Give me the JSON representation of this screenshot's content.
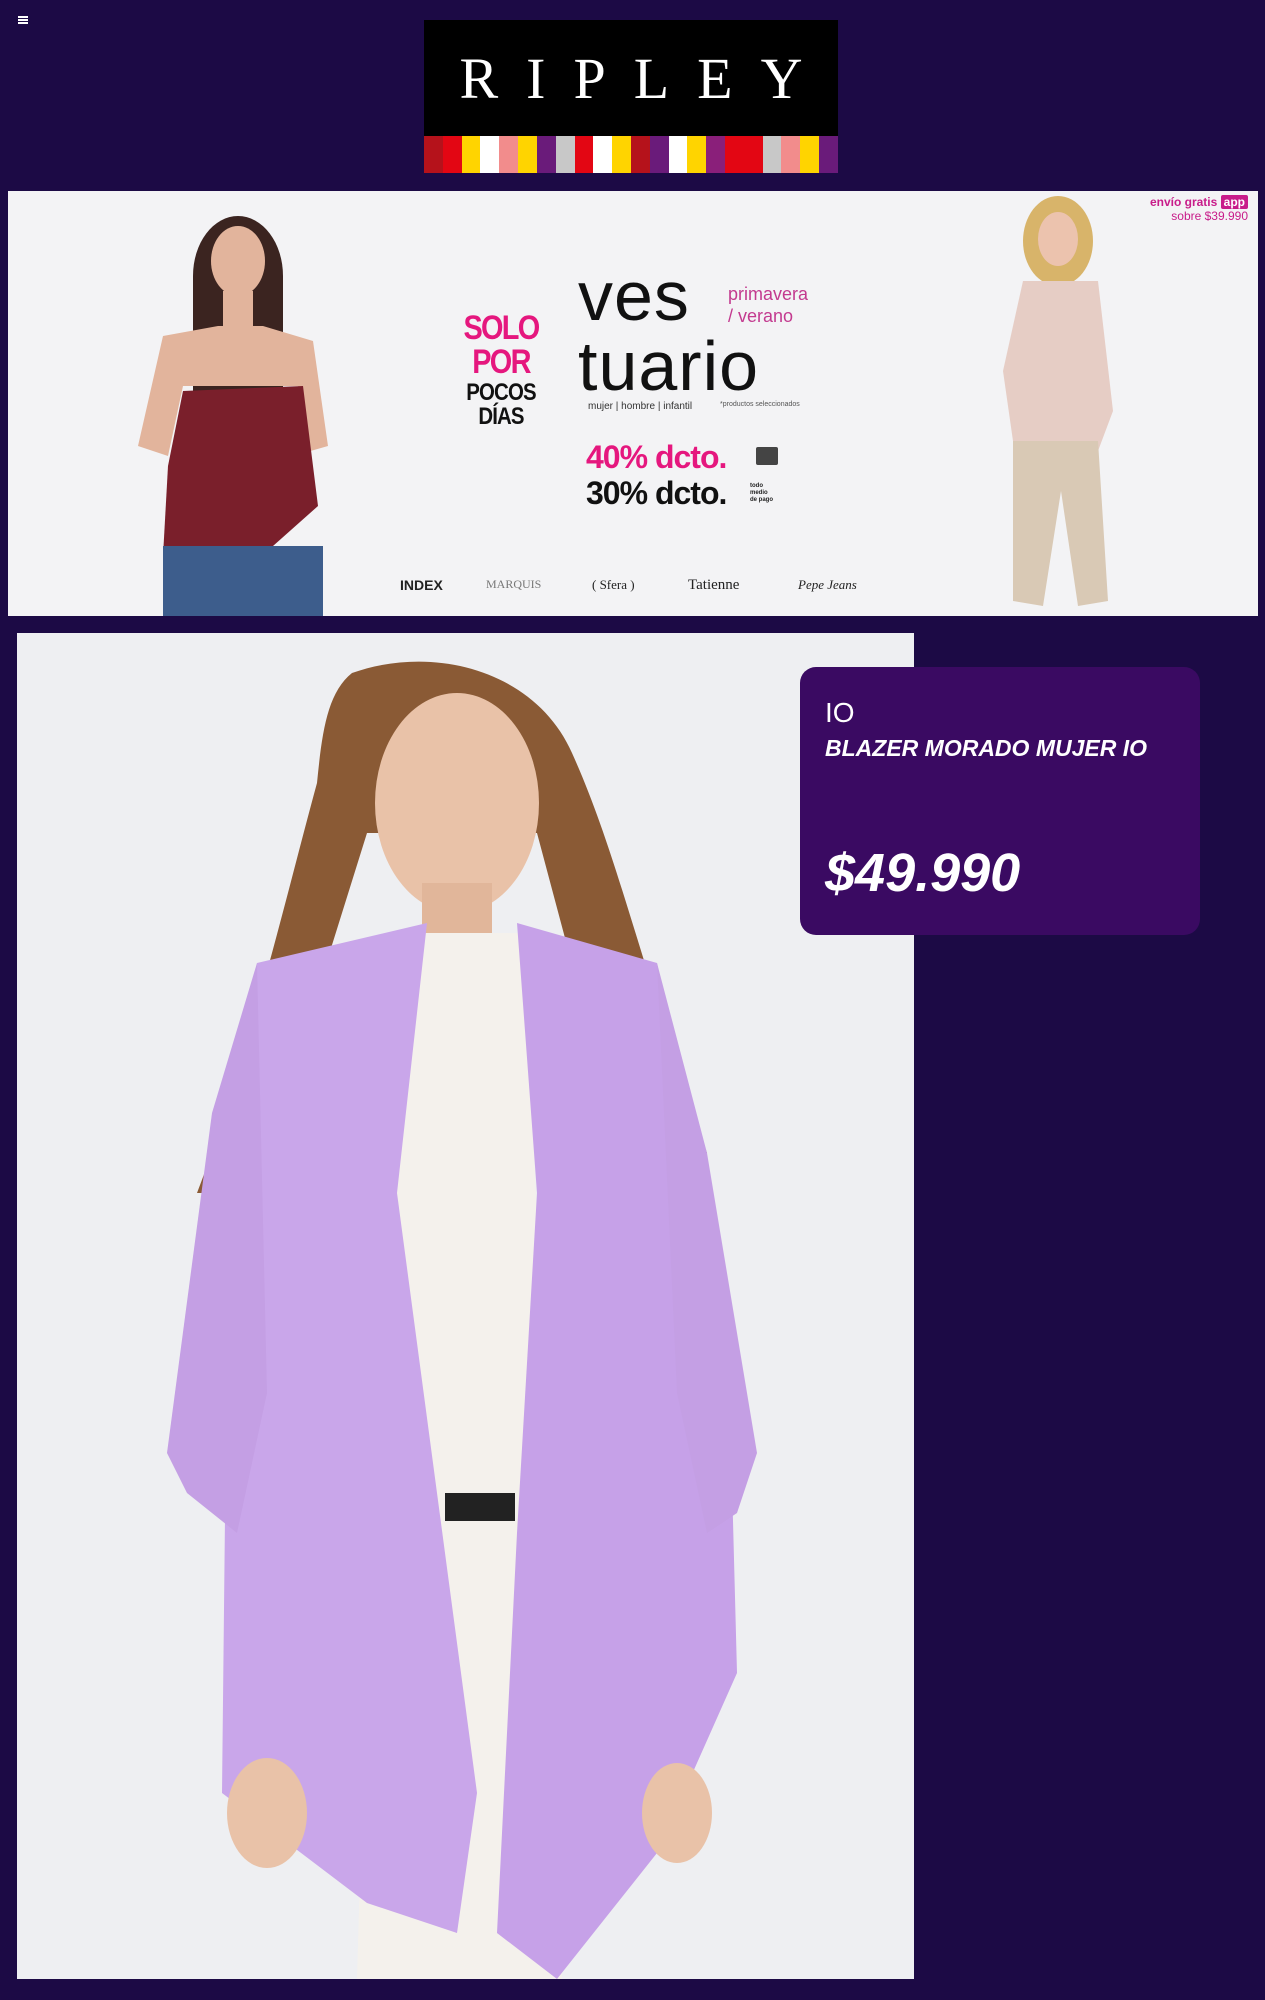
{
  "header": {
    "menu_icon": "menu-icon",
    "logo_text": "RIPLEY",
    "logo_stripe_colors": [
      "#b5121b",
      "#e30613",
      "#ffd400",
      "#ffffff",
      "#f28c8c",
      "#ffd400",
      "#6a1b7a",
      "#c8c8c8",
      "#e30613",
      "#ffffff",
      "#ffd400",
      "#b5121b",
      "#6a1b7a",
      "#ffffff",
      "#ffd400",
      "#8a1f7a",
      "#e30613",
      "#e30613",
      "#c8c8c8",
      "#f28c8c",
      "#ffd400",
      "#6a1b7a"
    ]
  },
  "banner": {
    "solo_line1": "SOLO POR",
    "solo_line2": "POCOS DÍAS",
    "title_line1": "ves",
    "title_line2": "tuario",
    "season_line1": "primavera",
    "season_line2": "/ verano",
    "categories": "mujer | hombre | infantil",
    "selected_note": "*productos seleccionados",
    "discount_40": "40% dcto.",
    "discount_30": "30% dcto.",
    "payment_note_1": "todo",
    "payment_note_2": "medio",
    "payment_note_3": "de pago",
    "shipping_label": "envío gratis",
    "shipping_app": "app",
    "shipping_condition": "sobre $39.990",
    "brands": [
      "INDEX",
      "MARQUIS",
      "( Sfera )",
      "Tatienne",
      "Pepe Jeans"
    ]
  },
  "product": {
    "brand": "IO",
    "name": "BLAZER MORADO MUJER IO",
    "price": "$49.990"
  },
  "colors": {
    "page_bg": "#1c0a45",
    "card_bg": "#3a0a62",
    "accent_pink": "#e5177e"
  }
}
